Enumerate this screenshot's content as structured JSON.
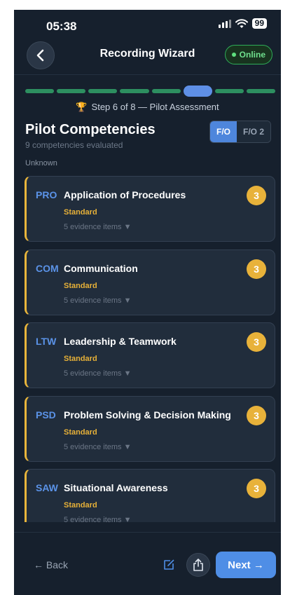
{
  "status_bar": {
    "time": "05:38",
    "battery": "99"
  },
  "nav": {
    "title": "Recording Wizard",
    "online_label": "Online"
  },
  "progress": {
    "total_steps": 8,
    "current_step": 6
  },
  "step_label": "Step 6 of 8 — Pilot Assessment",
  "header": {
    "title": "Pilot Competencies",
    "subtitle": "9 competencies evaluated",
    "context": "Unknown"
  },
  "pilot_toggle": {
    "selected": "F/O",
    "other": "F/O 2"
  },
  "competencies": [
    {
      "code": "PRO",
      "name": "Application of Procedures",
      "level": "Standard",
      "evidence": "5 evidence items ▼",
      "score": "3"
    },
    {
      "code": "COM",
      "name": "Communication",
      "level": "Standard",
      "evidence": "5 evidence items ▼",
      "score": "3"
    },
    {
      "code": "LTW",
      "name": "Leadership & Teamwork",
      "level": "Standard",
      "evidence": "5 evidence items ▼",
      "score": "3"
    },
    {
      "code": "PSD",
      "name": "Problem Solving & Decision Making",
      "level": "Standard",
      "evidence": "5 evidence items ▼",
      "score": "3"
    },
    {
      "code": "SAW",
      "name": "Situational Awareness",
      "level": "Standard",
      "evidence": "5 evidence items ▼",
      "score": "3"
    }
  ],
  "footer": {
    "back_label": "← Back",
    "next_label": "Next →"
  },
  "colors": {
    "accent_blue": "#4f8ee6",
    "standard_gold": "#e8b23a",
    "online_green": "#2fae58",
    "progress_green": "#2d8f60"
  },
  "icons": {
    "back": "chevron-left-icon",
    "step": "trophy-icon",
    "edit": "edit-icon",
    "share": "share-icon"
  }
}
